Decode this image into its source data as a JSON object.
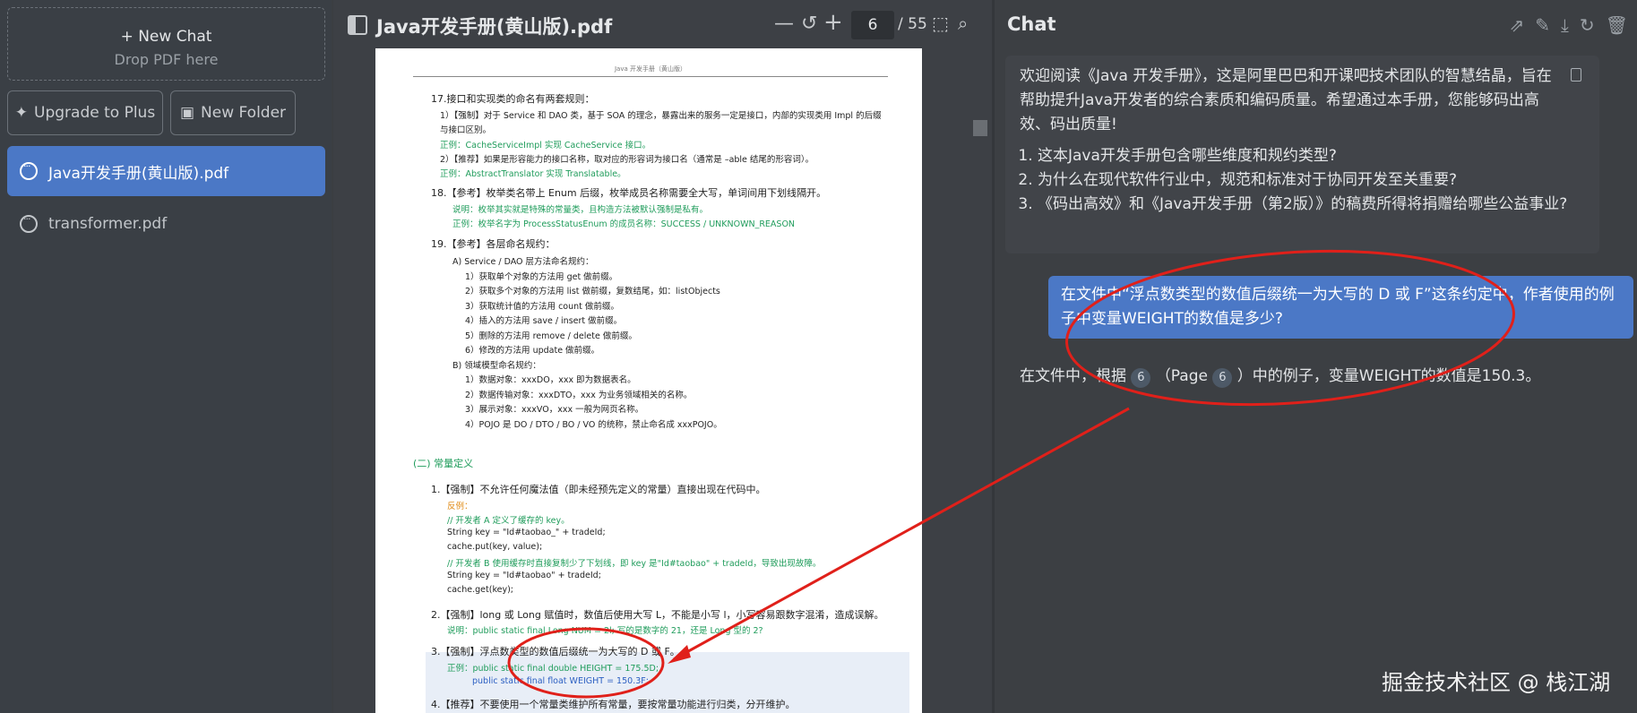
{
  "sidebar": {
    "new_chat": "+ New Chat",
    "drop_hint": "Drop PDF here",
    "upgrade": "Upgrade to Plus",
    "new_folder": "New Folder",
    "files": [
      "Java开发手册(黄山版).pdf",
      "transformer.pdf"
    ]
  },
  "pdf": {
    "title": "Java开发手册(黄山版).pdf",
    "page": "6",
    "total": "/ 55",
    "header": "Java 开发手册（黄山版）",
    "lines": [
      "17.接口和实现类的命名有两套规则：",
      "1）【强制】对于 Service 和 DAO 类，基于 SOA 的理念，暴露出来的服务一定是接口，内部的实现类用 Impl 的后缀",
      "与接口区别。",
      "正例：CacheServiceImpl 实现 CacheService 接口。",
      "2）【推荐】如果是形容能力的接口名称，取对应的形容词为接口名（通常是 –able 结尾的形容词）。",
      "正例：AbstractTranslator 实现 Translatable。",
      "18.【参考】枚举类名带上 Enum 后缀，枚举成员名称需要全大写，单词间用下划线隔开。",
      "说明：枚举其实就是特殊的常量类，且构造方法被默认强制是私有。",
      "正例：枚举名字为 ProcessStatusEnum 的成员名称：SUCCESS / UNKNOWN_REASON",
      "19.【参考】各层命名规约：",
      "A) Service / DAO 层方法命名规约：",
      "1）获取单个对象的方法用 get 做前缀。",
      "2）获取多个对象的方法用 list 做前缀，复数结尾，如：listObjects",
      "3）获取统计值的方法用 count 做前缀。",
      "4）插入的方法用 save / insert 做前缀。",
      "5）删除的方法用 remove / delete 做前缀。",
      "6）修改的方法用 update 做前缀。",
      "B) 领域模型命名规约：",
      "1）数据对象：xxxDO，xxx 即为数据表名。",
      "2）数据传输对象：xxxDTO，xxx 为业务领域相关的名称。",
      "3）展示对象：xxxVO，xxx 一般为网页名称。",
      "4）POJO 是 DO / DTO / BO / VO 的统称，禁止命名成 xxxPOJO。",
      "(二) 常量定义",
      "1.【强制】不允许任何魔法值（即未经预先定义的常量）直接出现在代码中。",
      "反例：",
      "// 开发者 A 定义了缓存的 key。",
      "String key = \"Id#taobao_\" + tradeId;",
      "cache.put(key, value);",
      "// 开发者 B 使用缓存时直接复制少了下划线，即 key 是\"Id#taobao\" + tradeId，导致出现故障。",
      "String key = \"Id#taobao\" + tradeId;",
      "cache.get(key);",
      "2.【强制】long 或 Long 赋值时，数值后使用大写 L，不能是小写 l，小写容易跟数字混淆，造成误解。",
      "说明：public static final Long NUM = 2l; 写的是数字的 21，还是 Long 型的 2?",
      "3.【强制】浮点数类型的数值后缀统一为大写的 D 或 F。",
      "正例：public static final double HEIGHT = 175.5D;",
      "public static final float WEIGHT = 150.3F;",
      "4.【推荐】不要使用一个常量类维护所有常量，要按常量功能进行归类，分开维护。"
    ]
  },
  "chat": {
    "title": "Chat",
    "intro": "欢迎阅读《Java 开发手册》，这是阿里巴巴和开课吧技术团队的智慧结晶，旨在帮助提升Java开发者的综合素质和编码质量。希望通过本手册，您能够码出高效、码出质量!",
    "questions": [
      "这本Java开发手册包含哪些维度和规约类型?",
      "为什么在现代软件行业中，规范和标准对于协同开发至关重要?",
      "《码出高效》和《Java开发手册（第2版）》的稿费所得将捐赠给哪些公益事业?"
    ],
    "user_question": "在文件中“浮点数类型的数值后缀统一为大写的 D 或 F”这条约定中，作者使用的例子中变量WEIGHT的数值是多少?",
    "answer_a": "在文件中，根据",
    "cite1": "6",
    "answer_b": "（Page",
    "cite2": "6",
    "answer_c": "）中的例子，变量WEIGHT的数值是150.3。"
  },
  "watermark": "掘金技术社区 @ 栈江湖",
  "colors": {
    "accent": "#4b78c6",
    "annotation": "#e0201a"
  }
}
